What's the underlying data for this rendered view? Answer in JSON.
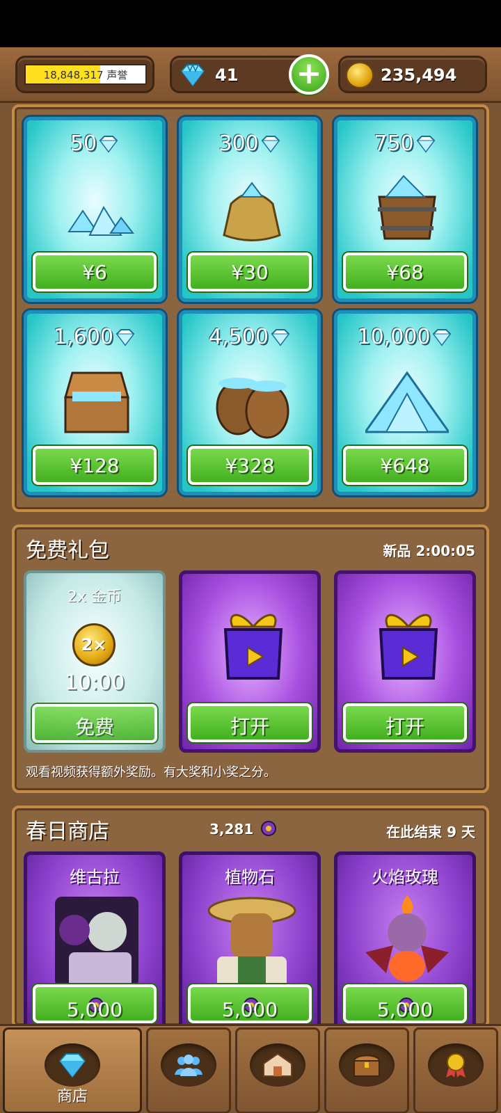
{
  "header": {
    "reputation_value": "18,848,317",
    "reputation_label": "声誉",
    "reputation_progress": 0.62,
    "gems": "41",
    "coins": "235,494",
    "icons": [
      "gem-icon",
      "plus-icon",
      "coin-icon"
    ]
  },
  "gem_shop": {
    "items": [
      {
        "amount": "50",
        "price": "¥6",
        "art": "small-gem-pile"
      },
      {
        "amount": "300",
        "price": "¥30",
        "art": "gem-sack"
      },
      {
        "amount": "750",
        "price": "¥68",
        "art": "gem-bucket"
      },
      {
        "amount": "1,600",
        "price": "¥128",
        "art": "gem-chest"
      },
      {
        "amount": "4,500",
        "price": "¥328",
        "art": "gem-barrels"
      },
      {
        "amount": "10,000",
        "price": "¥648",
        "art": "gem-mountain"
      }
    ]
  },
  "free_gifts": {
    "title": "免费礼包",
    "new_label": "新品 2:00:05",
    "cards": [
      {
        "title": "2x 金币",
        "badge": "2×",
        "timer": "10:00",
        "button": "免费"
      },
      {
        "button": "打开"
      },
      {
        "button": "打开"
      }
    ],
    "note": "观看视频获得额外奖励。有大奖和小奖之分。"
  },
  "spring_shop": {
    "title": "春日商店",
    "currency": "3,281",
    "ends": "在此结束 9 天",
    "items": [
      {
        "name": "维古拉",
        "price": "5,000"
      },
      {
        "name": "植物石",
        "price": "5,000"
      },
      {
        "name": "火焰玫瑰",
        "price": "5,000"
      }
    ]
  },
  "nav": {
    "items": [
      {
        "label": "商店",
        "icon": "gem-icon",
        "active": true
      },
      {
        "icon": "people-icon"
      },
      {
        "icon": "house-icon"
      },
      {
        "icon": "chest-icon"
      },
      {
        "icon": "medal-icon"
      }
    ]
  },
  "colors": {
    "wood": "#7a5533",
    "gem_card": "#26c6c8",
    "button_green": "#42b020",
    "purple_card": "#8b3fcc"
  }
}
